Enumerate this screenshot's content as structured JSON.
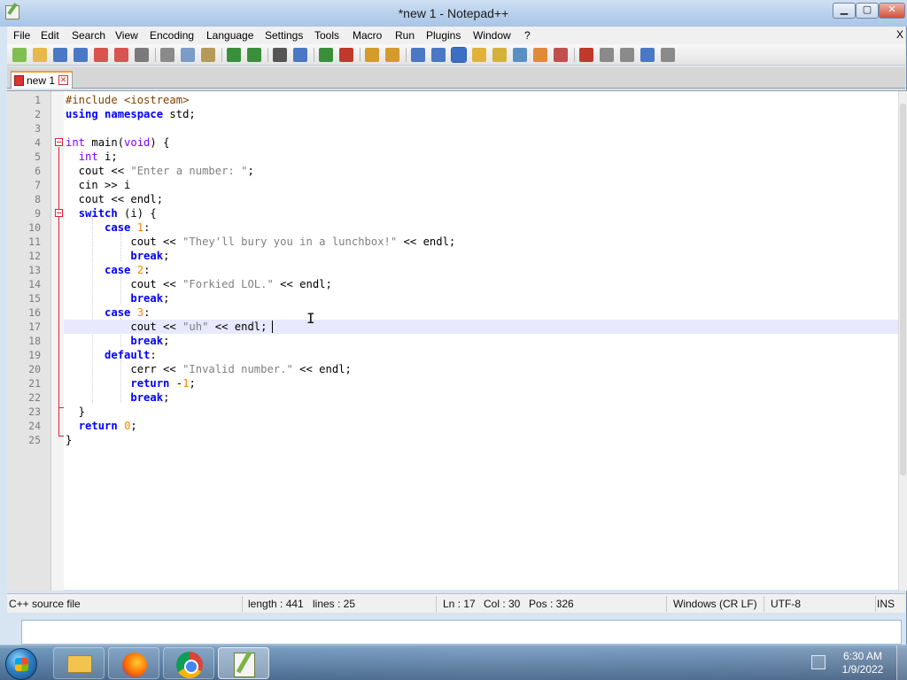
{
  "window": {
    "title": "*new 1 - Notepad++",
    "min_glyph": "▁",
    "max_glyph": "▢",
    "close_glyph": "✕"
  },
  "menu": {
    "items": [
      "File",
      "Edit",
      "Search",
      "View",
      "Encoding",
      "Language",
      "Settings",
      "Tools",
      "Macro",
      "Run",
      "Plugins",
      "Window",
      "?"
    ],
    "overflow_glyph": "X"
  },
  "toolbar": {
    "icons": [
      "new-file-icon",
      "open-file-icon",
      "save-icon",
      "save-all-icon",
      "close-icon",
      "close-all-icon",
      "print-icon",
      "cut-icon",
      "copy-icon",
      "paste-icon",
      "undo-icon",
      "redo-icon",
      "find-icon",
      "replace-icon",
      "zoom-in-icon",
      "zoom-out-icon",
      "sync-vertical-icon",
      "sync-horizontal-icon",
      "word-wrap-icon",
      "show-all-chars-icon",
      "indent-guide-icon",
      "user-language-icon",
      "doc-map-icon",
      "function-list-icon",
      "folder-workspace-icon",
      "monitoring-icon",
      "record-macro-icon",
      "stop-macro-icon",
      "play-macro-icon",
      "run-macro-multiple-icon",
      "save-macro-icon"
    ]
  },
  "tabs": [
    {
      "label": "new 1",
      "close_glyph": "✕"
    }
  ],
  "editor": {
    "current_line": 17,
    "lines": [
      [
        [
          "pre",
          "#include <iostream>"
        ]
      ],
      [
        [
          "kw",
          "using"
        ],
        [
          "plain",
          " "
        ],
        [
          "kw",
          "namespace"
        ],
        [
          "plain",
          " std;"
        ]
      ],
      [],
      [
        [
          "kw2",
          "int"
        ],
        [
          "plain",
          " main("
        ],
        [
          "kw2",
          "void"
        ],
        [
          "plain",
          ") {"
        ]
      ],
      [
        [
          "plain",
          "  "
        ],
        [
          "kw2",
          "int"
        ],
        [
          "plain",
          " i;"
        ]
      ],
      [
        [
          "plain",
          "  cout << "
        ],
        [
          "str",
          "\"Enter a number: \""
        ],
        [
          "plain",
          ";"
        ]
      ],
      [
        [
          "plain",
          "  cin >> i"
        ]
      ],
      [
        [
          "plain",
          "  cout << endl;"
        ]
      ],
      [
        [
          "plain",
          "  "
        ],
        [
          "kw",
          "switch"
        ],
        [
          "plain",
          " (i) {"
        ]
      ],
      [
        [
          "plain",
          "      "
        ],
        [
          "kw",
          "case"
        ],
        [
          "plain",
          " "
        ],
        [
          "num",
          "1"
        ],
        [
          "plain",
          ":"
        ]
      ],
      [
        [
          "plain",
          "          cout << "
        ],
        [
          "str",
          "\"They'll bury you in a lunchbox!\""
        ],
        [
          "plain",
          " << endl;"
        ]
      ],
      [
        [
          "plain",
          "          "
        ],
        [
          "kw",
          "break"
        ],
        [
          "plain",
          ";"
        ]
      ],
      [
        [
          "plain",
          "      "
        ],
        [
          "kw",
          "case"
        ],
        [
          "plain",
          " "
        ],
        [
          "num",
          "2"
        ],
        [
          "plain",
          ":"
        ]
      ],
      [
        [
          "plain",
          "          cout << "
        ],
        [
          "str",
          "\"Forkied LOL.\""
        ],
        [
          "plain",
          " << endl;"
        ]
      ],
      [
        [
          "plain",
          "          "
        ],
        [
          "kw",
          "break"
        ],
        [
          "plain",
          ";"
        ]
      ],
      [
        [
          "plain",
          "      "
        ],
        [
          "kw",
          "case"
        ],
        [
          "plain",
          " "
        ],
        [
          "num",
          "3"
        ],
        [
          "plain",
          ":"
        ]
      ],
      [
        [
          "plain",
          "          cout << "
        ],
        [
          "str",
          "\"uh\""
        ],
        [
          "plain",
          " << endl;"
        ]
      ],
      [
        [
          "plain",
          "          "
        ],
        [
          "kw",
          "break"
        ],
        [
          "plain",
          ";"
        ]
      ],
      [
        [
          "plain",
          "      "
        ],
        [
          "kw",
          "default"
        ],
        [
          "plain",
          ":"
        ]
      ],
      [
        [
          "plain",
          "          cerr << "
        ],
        [
          "str",
          "\"Invalid number.\""
        ],
        [
          "plain",
          " << endl;"
        ]
      ],
      [
        [
          "plain",
          "          "
        ],
        [
          "kw",
          "return"
        ],
        [
          "plain",
          " -"
        ],
        [
          "num",
          "1"
        ],
        [
          "plain",
          ";"
        ]
      ],
      [
        [
          "plain",
          "          "
        ],
        [
          "kw",
          "break"
        ],
        [
          "plain",
          ";"
        ]
      ],
      [
        [
          "plain",
          "  }"
        ]
      ],
      [
        [
          "plain",
          "  "
        ],
        [
          "kw",
          "return"
        ],
        [
          "plain",
          " "
        ],
        [
          "num",
          "0"
        ],
        [
          "plain",
          ";"
        ]
      ],
      [
        [
          "plain",
          "}"
        ]
      ]
    ]
  },
  "status": {
    "file_type": "C++ source file",
    "length": "length : 441",
    "lines": "lines : 25",
    "ln": "Ln : 17",
    "col": "Col : 30",
    "pos": "Pos : 326",
    "eol": "Windows (CR LF)",
    "encoding": "UTF-8",
    "mode": "INS"
  },
  "taskbar": {
    "apps": [
      "windows-explorer",
      "firefox",
      "chrome",
      "notepad-plus-plus"
    ],
    "time": "6:30 AM",
    "date": "1/9/2022"
  },
  "colors": {
    "keyword": "#0000ff",
    "type_keyword": "#8000ff",
    "string": "#808080",
    "number": "#ff8000",
    "preprocessor": "#804000",
    "current_line_bg": "#e8e8ff",
    "fold_marker": "#dd2233"
  }
}
